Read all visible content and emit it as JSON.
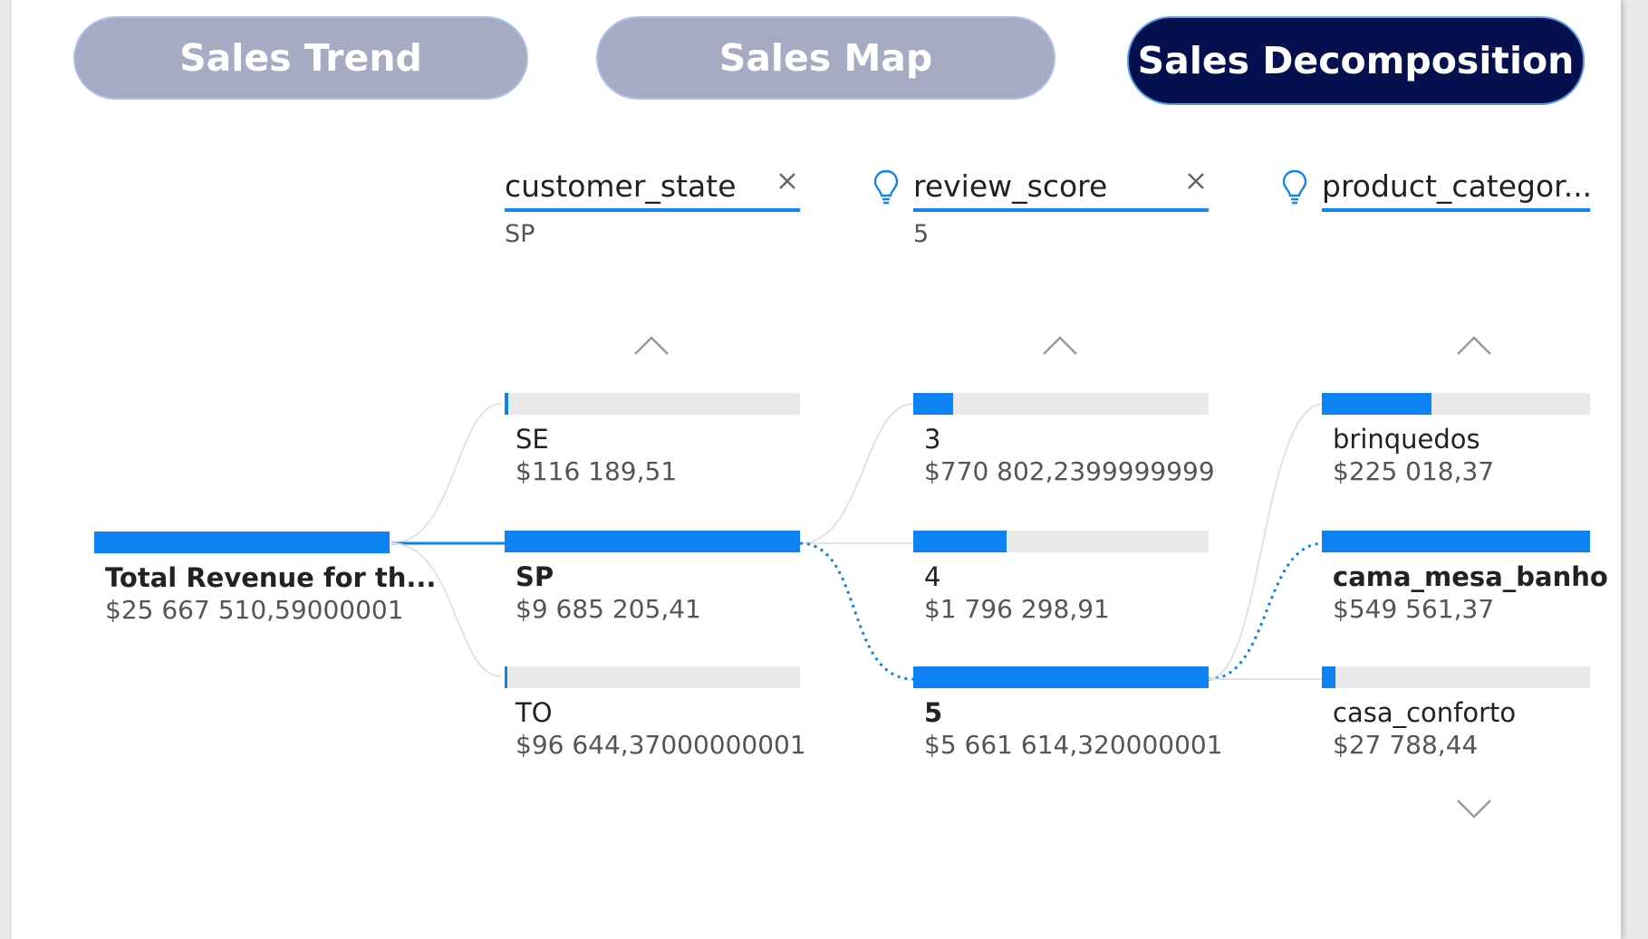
{
  "tabs": [
    {
      "label": "Sales Trend",
      "active": false
    },
    {
      "label": "Sales Map",
      "active": false
    },
    {
      "label": "Sales Decomposition",
      "active": true
    }
  ],
  "root": {
    "label": "Total Revenue for th...",
    "value": "$25 667 510,59000001",
    "fraction": 1.0
  },
  "levels": [
    {
      "field": "customer_state",
      "selected": "SP",
      "nodes": [
        {
          "label": "SE",
          "value": "$116 189,51",
          "fraction": 0.012,
          "bold": false
        },
        {
          "label": "SP",
          "value": "$9 685 205,41",
          "fraction": 1.0,
          "bold": true
        },
        {
          "label": "TO",
          "value": "$96 644,37000000001",
          "fraction": 0.01,
          "bold": false
        }
      ]
    },
    {
      "field": "review_score",
      "selected": "5",
      "nodes": [
        {
          "label": "3",
          "value": "$770 802,2399999999",
          "fraction": 0.136,
          "bold": false
        },
        {
          "label": "4",
          "value": "$1 796 298,91",
          "fraction": 0.317,
          "bold": false
        },
        {
          "label": "5",
          "value": "$5 661 614,320000001",
          "fraction": 1.0,
          "bold": true
        }
      ]
    },
    {
      "field": "product_categor...",
      "selected": "",
      "nodes": [
        {
          "label": "brinquedos",
          "value": "$225 018,37",
          "fraction": 0.41,
          "bold": false
        },
        {
          "label": "cama_mesa_banho",
          "value": "$549 561,37",
          "fraction": 1.0,
          "bold": true
        },
        {
          "label": "casa_conforto",
          "value": "$27 788,44",
          "fraction": 0.05,
          "bold": false
        }
      ]
    }
  ],
  "colors": {
    "accent": "#0d82f2",
    "tab_inactive": "#a6abc3",
    "tab_active": "#07104f",
    "track": "#e9e9e9"
  },
  "icons": {
    "remove": "close-icon",
    "ai_split": "lightbulb-icon",
    "scroll_up": "chevron-up-icon",
    "scroll_down": "chevron-down-icon"
  }
}
